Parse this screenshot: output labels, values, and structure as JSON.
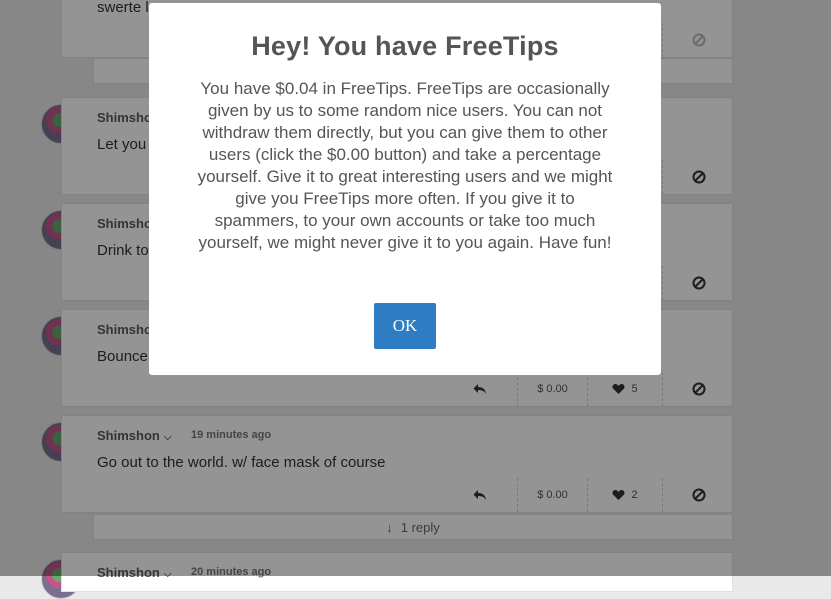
{
  "posts": [
    {
      "username": "",
      "time": "",
      "text": "swerte l",
      "reply_count": ""
    },
    {
      "username": "Shimshon",
      "time": "",
      "text": "Let you",
      "tip": "",
      "likes": ""
    },
    {
      "username": "Shimshon",
      "time": "",
      "text": "Drink to",
      "tip": "",
      "likes": ""
    },
    {
      "username": "Shimshon",
      "time": "",
      "text": "Bounce",
      "tip": "$ 0.00",
      "likes": "5"
    },
    {
      "username": "Shimshon",
      "time": "19 minutes ago",
      "text": "Go out to the world. w/ face mask of course",
      "tip": "$ 0.00",
      "likes": "2"
    },
    {
      "username": "Shimshon",
      "time": "20 minutes ago",
      "text": ""
    }
  ],
  "replies_bar": {
    "label": "1 reply"
  },
  "modal": {
    "title": "Hey! You have FreeTips",
    "body": "You have $0.04 in FreeTips. FreeTips are occasionally given by us to some random nice users. You can not withdraw them directly, but you can give them to other users (click the $0.00 button) and take a percentage yourself. Give it to great interesting users and we might give you FreeTips more often. If you give it to spammers, to your own accounts or take too much yourself, we might never give it to you again. Have fun!",
    "ok_label": "OK"
  },
  "colors": {
    "primary": "#2e7dc4",
    "overlay": "rgba(0,0,0,0.42)"
  },
  "icons": [
    "reply-icon",
    "heart-icon",
    "block-icon",
    "arrow-down-icon",
    "chevron-down-icon"
  ]
}
